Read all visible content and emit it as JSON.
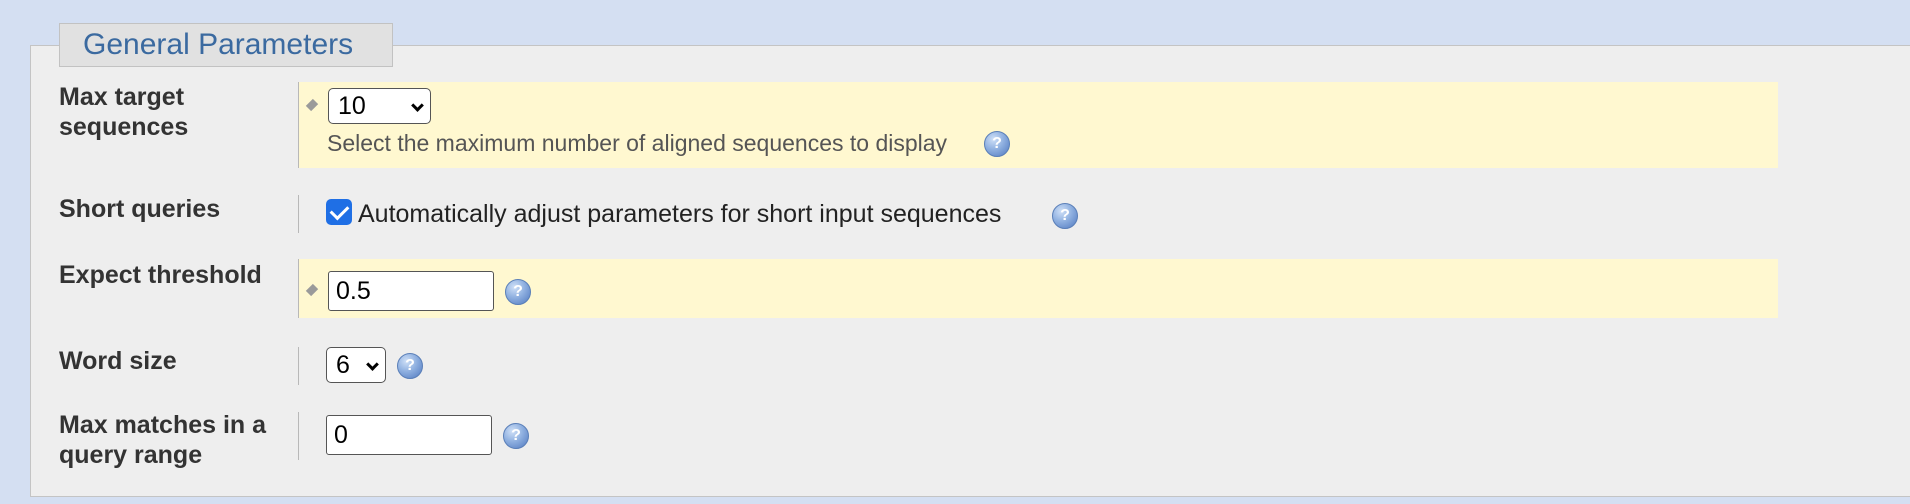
{
  "section": {
    "title": "General Parameters"
  },
  "max_target_sequences": {
    "label": "Max target sequences",
    "value": "10",
    "hint": "Select the maximum number of aligned sequences to display"
  },
  "short_queries": {
    "label": "Short queries",
    "checked": true,
    "checkbox_label": "Automatically adjust parameters for short input sequences"
  },
  "expect_threshold": {
    "label": "Expect threshold",
    "value": "0.5"
  },
  "word_size": {
    "label": "Word size",
    "value": "6"
  },
  "max_matches": {
    "label": "Max matches in a query range",
    "value": "0"
  },
  "icons": {
    "help": "help-icon",
    "modified": "diamond-marker-icon"
  },
  "colors": {
    "page_background": "#d4dff2",
    "panel_background": "#eeeeee",
    "highlight_background": "#fff8d0",
    "legend_text": "#3b6aa0",
    "checkbox_accent": "#1f6fe5"
  }
}
